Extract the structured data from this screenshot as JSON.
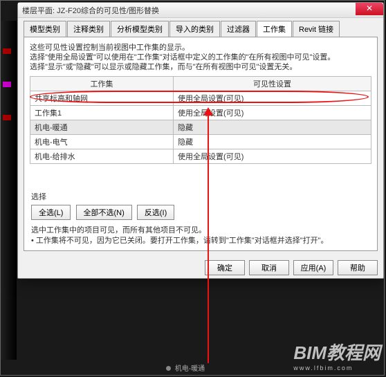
{
  "dialog": {
    "title": "楼层平面: JZ-F20综合的可见性/图形替换",
    "tabs": [
      "模型类别",
      "注释类别",
      "分析模型类别",
      "导入的类别",
      "过滤器",
      "工作集",
      "Revit 链接"
    ],
    "active_tab": 5,
    "info_line1": "这些可见性设置控制当前视图中工作集的显示。",
    "info_line2": "选择\"使用全局设置\"可以使用在\"工作集\"对话框中定义的工作集的\"在所有视图中可见\"设置。",
    "info_line3": "选择\"显示\"或\"隐藏\"可以显示或隐藏工作集，而与\"在所有视图中可见\"设置无关。",
    "columns": [
      "工作集",
      "可见性设置"
    ],
    "rows": [
      {
        "name": "共享标高和轴网",
        "vis": "使用全局设置(可见)"
      },
      {
        "name": "工作集1",
        "vis": "使用全局设置(可见)"
      },
      {
        "name": "机电-暖通",
        "vis": "隐藏",
        "hl": true
      },
      {
        "name": "机电-电气",
        "vis": "隐藏"
      },
      {
        "name": "机电-给排水",
        "vis": "使用全局设置(可见)"
      }
    ],
    "select_label": "选择",
    "select_all": "全选(L)",
    "select_none": "全部不选(N)",
    "invert": "反选(I)",
    "note1": "选中工作集中的项目可见，而所有其他项目不可见。",
    "note2": "• 工作集将不可见，因为它已关闭。要打开工作集，请转到\"工作集\"对话框并选择\"打开\"。",
    "ok": "确定",
    "cancel": "取消",
    "apply": "应用(A)",
    "help": "帮助"
  },
  "watermark": {
    "big": "BIM教程网",
    "small": "www.lfbim.com"
  },
  "status": "机电-暖通"
}
